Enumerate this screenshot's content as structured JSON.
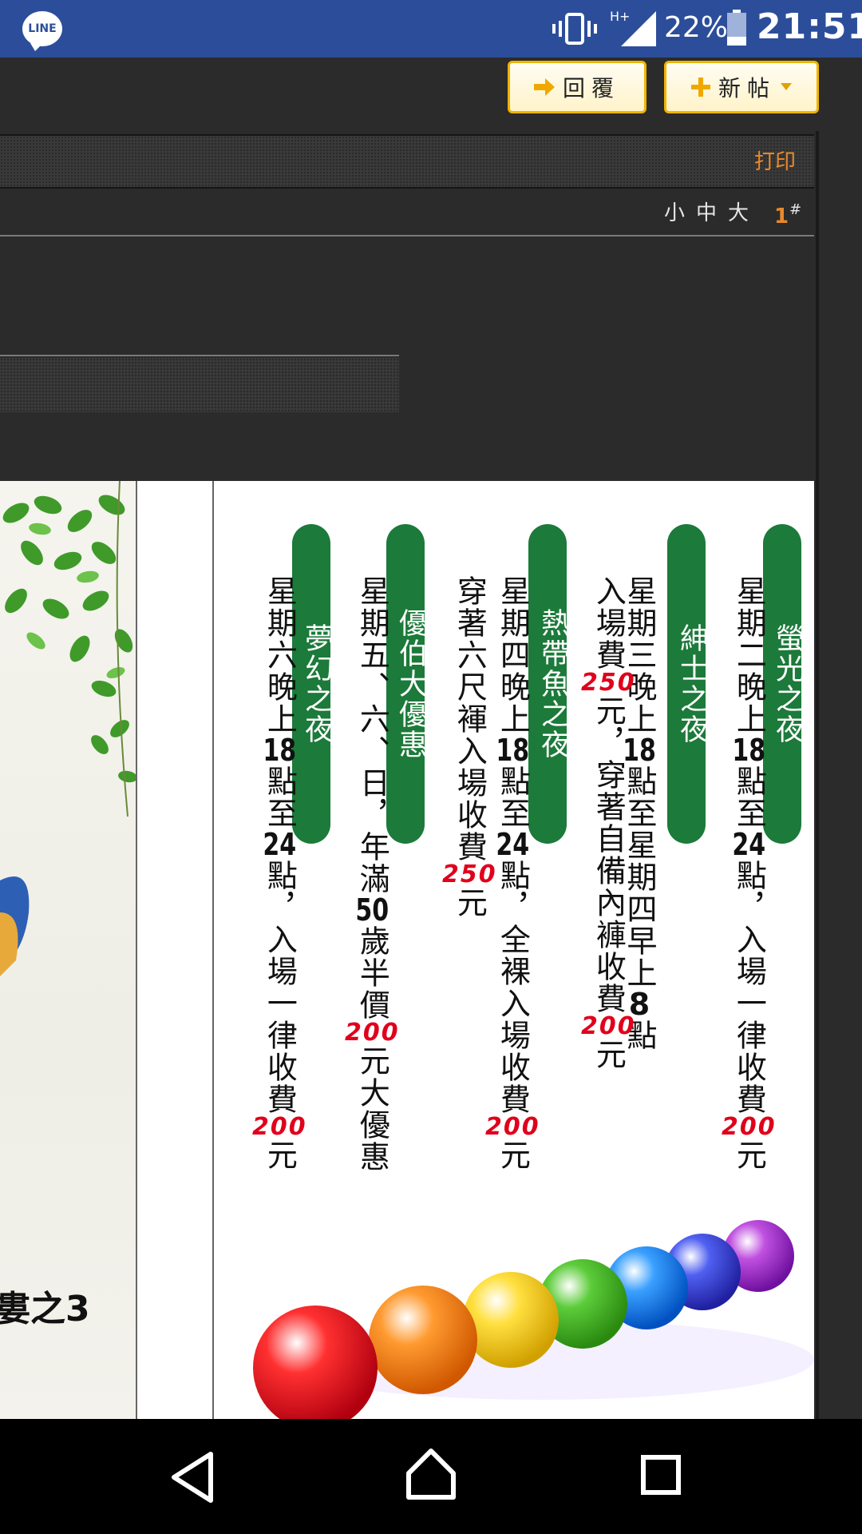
{
  "status_bar": {
    "app_icon": "line-icon",
    "app_icon_text": "LINE",
    "battery_percent": "22%",
    "time": "21:51",
    "network": "H+"
  },
  "toolbar": {
    "reply_label": "回覆",
    "new_post_label": "新帖"
  },
  "post": {
    "print_label": "打印",
    "font_sizes": "小中大",
    "floor_number": "1",
    "floor_suffix": "#"
  },
  "poster": {
    "left_caption": "婁之3",
    "nights": [
      {
        "title": "螢光之夜",
        "lines": [
          [
            "星期二晚上",
            "18",
            "點至",
            "24",
            "點，入場一律收費",
            "200",
            "元"
          ]
        ]
      },
      {
        "title": "紳士之夜",
        "lines": [
          [
            "星期三晚上",
            "18",
            "點至星期四早上",
            "8",
            "點"
          ],
          [
            "入場費",
            "250",
            "元，穿著自備內褲收費",
            "200",
            "元"
          ]
        ]
      },
      {
        "title": "熱帶魚之夜",
        "lines": [
          [
            "星期四晚上",
            "18",
            "點至",
            "24",
            "點，全裸入場收費",
            "200",
            "元"
          ],
          [
            "穿著六尺褌入場收費",
            "250",
            "元"
          ]
        ]
      },
      {
        "title": "優伯大優惠",
        "lines": [
          [
            "星期五、六、日，年滿",
            "50",
            "歲半價",
            "200",
            "元大優惠"
          ]
        ]
      },
      {
        "title": "夢幻之夜",
        "lines": [
          [
            "星期六晚上",
            "18",
            "點至",
            "24",
            "點，入場一律收費",
            "200",
            "元"
          ]
        ]
      }
    ]
  },
  "nav_bar": {
    "back": "back-icon",
    "home": "home-icon",
    "recent": "recent-apps-icon"
  }
}
